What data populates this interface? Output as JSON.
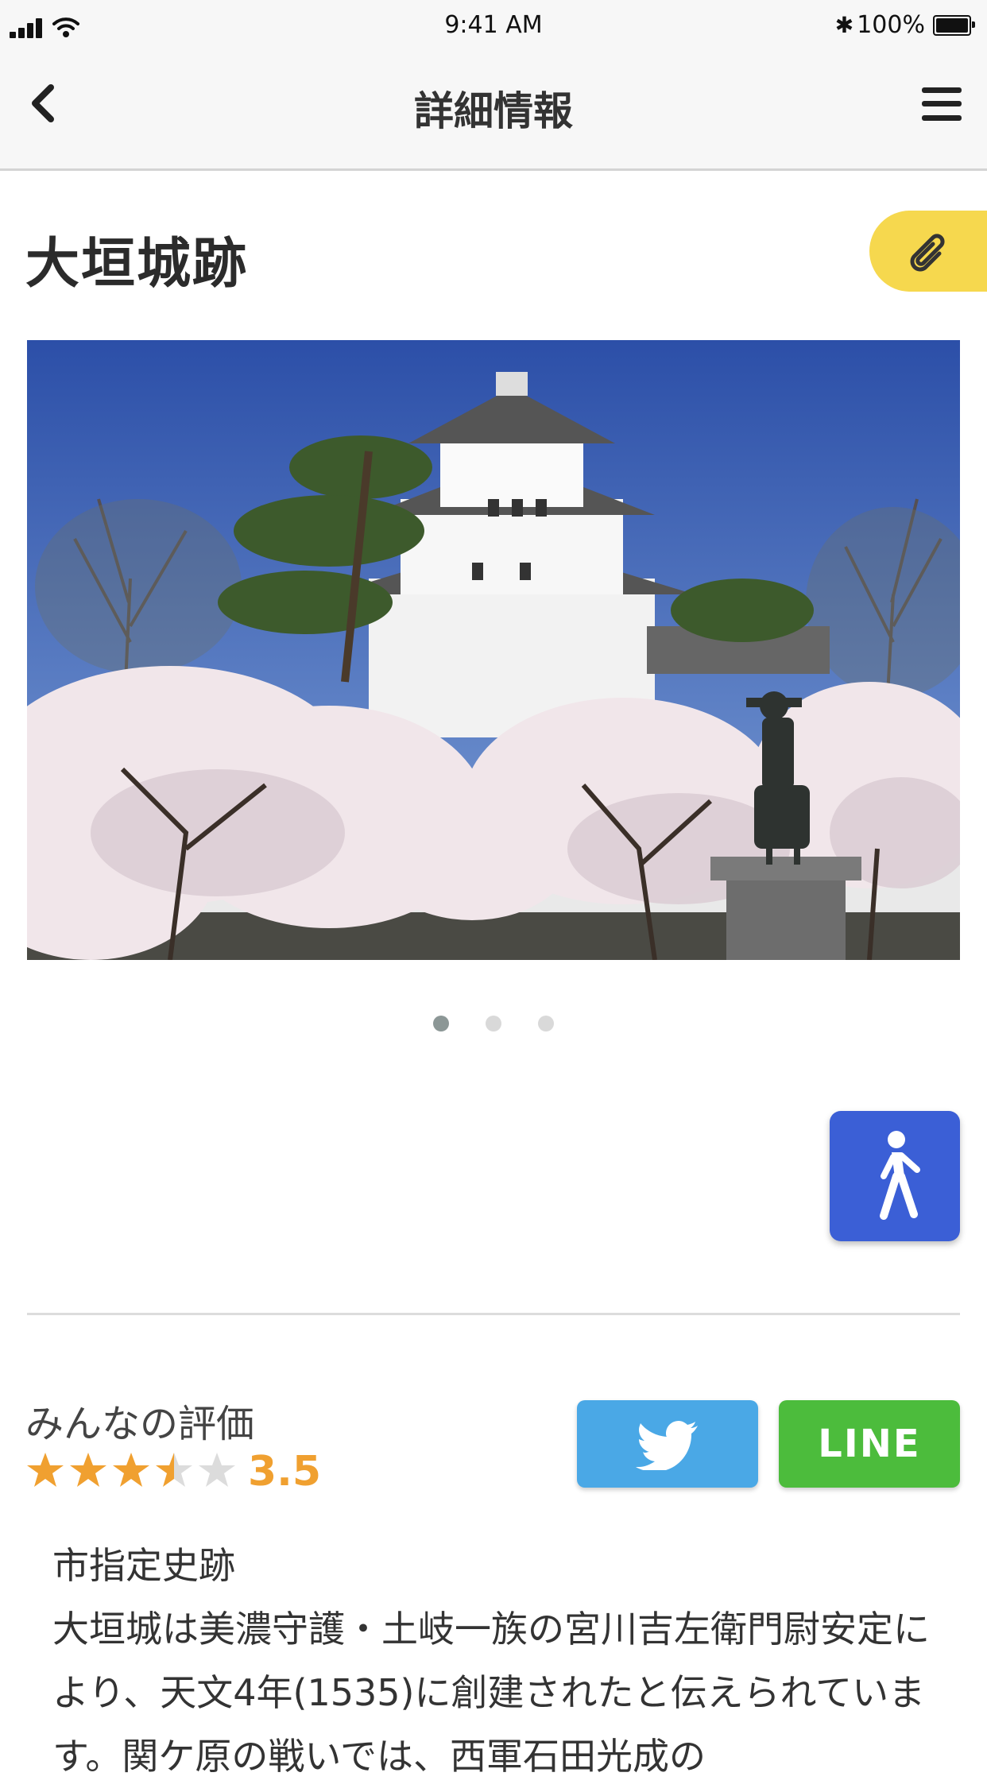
{
  "status_bar": {
    "time": "9:41 AM",
    "battery": "100%",
    "icons": [
      "signal-icon",
      "wifi-icon",
      "bluetooth-icon",
      "battery-icon"
    ]
  },
  "nav": {
    "title": "詳細情報",
    "back_icon": "chevron-left-icon",
    "menu_icon": "hamburger-menu-icon"
  },
  "place": {
    "name": "大垣城跡",
    "clip_icon": "paperclip-icon",
    "photo_description_icon": "castle-photo",
    "carousel": {
      "total": 3,
      "active_index": 0
    }
  },
  "walk_button_icon": "pedestrian-icon",
  "rating": {
    "label": "みんなの評価",
    "value": "3.5",
    "stars_out_of": 5,
    "stars_value": 3.5
  },
  "share": {
    "twitter_icon": "twitter-bird-icon",
    "line_label": "LINE"
  },
  "description": {
    "category": "市指定史跡",
    "text": "大垣城は美濃守護・土岐一族の宮川吉左衛門尉安定により、天文4年(1535)に創建されたと伝えられています。関ケ原の戦いでは、西軍石田光成の"
  },
  "colors": {
    "clip_button": "#f6d84e",
    "walk_button": "#3b5fd6",
    "twitter": "#4aa8e6",
    "line": "#4cbc3c",
    "star": "#f0a030",
    "rating_value": "#f0a030"
  }
}
